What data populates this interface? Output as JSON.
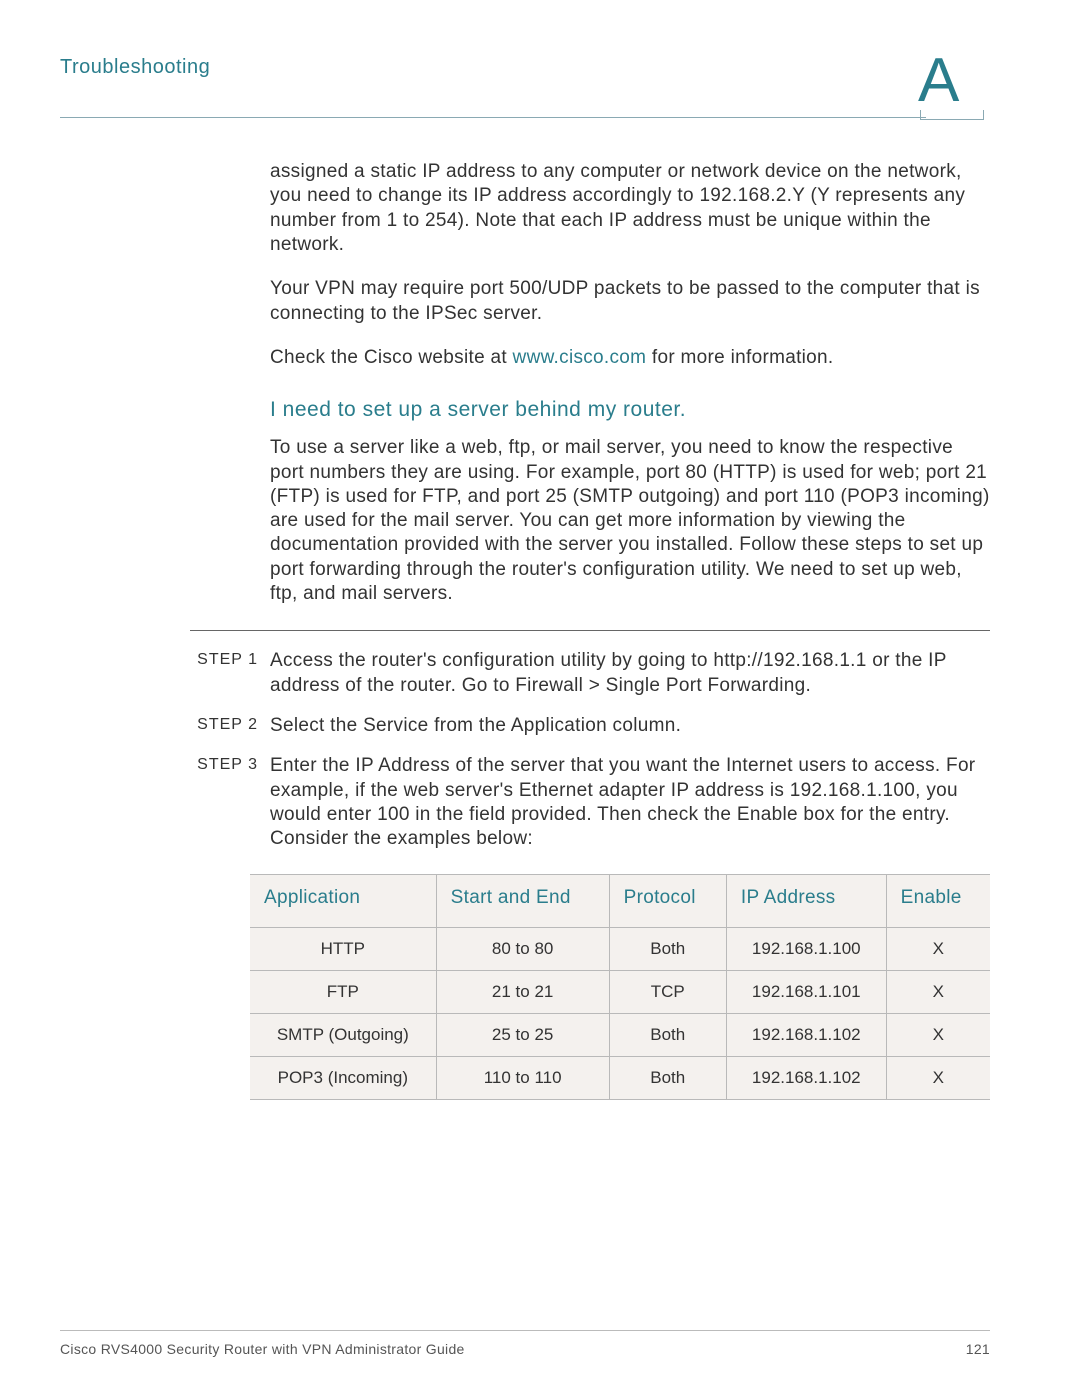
{
  "header": {
    "section_title": "Troubleshooting",
    "appendix_letter": "A"
  },
  "body": {
    "para1": "assigned a static IP address to any computer or network device on the network, you need to change its IP address accordingly to 192.168.2.Y (Y represents any number from 1 to 254). Note that each IP address must be unique within the network.",
    "para2": "Your VPN may require port 500/UDP packets to be passed to the computer that is connecting to the IPSec server.",
    "para3_prefix": "Check the Cisco website at ",
    "para3_link": "www.cisco.com",
    "para3_suffix": " for more information.",
    "subhead": "I need to set up a server behind my router.",
    "para4": "To use a server like a web, ftp, or mail server, you need to know the respective port numbers they are using. For example, port 80 (HTTP) is used for web; port 21 (FTP) is used for FTP, and port 25 (SMTP outgoing) and port 110 (POP3 incoming) are used for the mail server. You can get more information by viewing the documentation provided with the server you installed. Follow these steps to set up port forwarding through the router's configuration utility. We need to set up web, ftp, and mail servers."
  },
  "steps": [
    {
      "label": "STEP  1",
      "text": "Access the router's configuration utility by going to http://192.168.1.1 or the IP address of the router. Go to Firewall > Single Port Forwarding."
    },
    {
      "label": "STEP  2",
      "text": "Select the Service from the Application column."
    },
    {
      "label": "STEP  3",
      "text": "Enter the IP Address of the server that you want the Internet users to access. For example, if the web server's Ethernet adapter IP address is 192.168.1.100, you would enter 100 in the field provided. Then check the Enable box for the entry. Consider the examples below:"
    }
  ],
  "table": {
    "headers": [
      "Application",
      "Start and End",
      "Protocol",
      "IP Address",
      "Enable"
    ],
    "rows": [
      [
        "HTTP",
        "80 to 80",
        "Both",
        "192.168.1.100",
        "X"
      ],
      [
        "FTP",
        "21 to 21",
        "TCP",
        "192.168.1.101",
        "X"
      ],
      [
        "SMTP (Outgoing)",
        "25 to 25",
        "Both",
        "192.168.1.102",
        "X"
      ],
      [
        "POP3 (Incoming)",
        "110 to 110",
        "Both",
        "192.168.1.102",
        "X"
      ]
    ]
  },
  "footer": {
    "doc_title": "Cisco RVS4000 Security Router with VPN Administrator Guide",
    "page_number": "121"
  }
}
